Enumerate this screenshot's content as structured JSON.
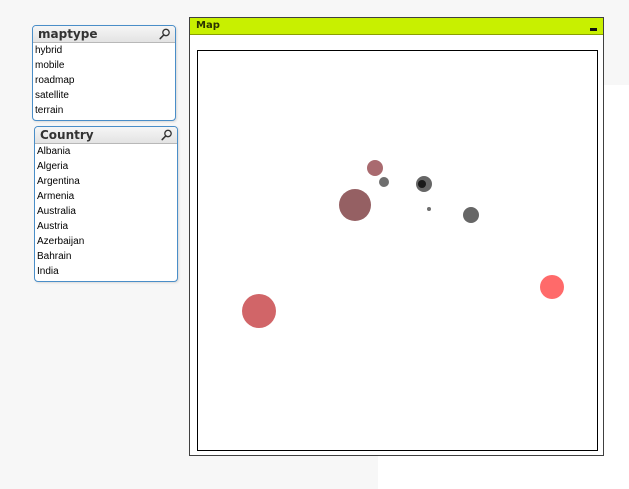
{
  "maptype_listbox": {
    "title": "maptype",
    "icon": "search-icon",
    "items": [
      "hybrid",
      "mobile",
      "roadmap",
      "satellite",
      "terrain"
    ]
  },
  "country_listbox": {
    "title": "Country",
    "icon": "search-icon",
    "items": [
      "Albania",
      "Algeria",
      "Argentina",
      "Armenia",
      "Australia",
      "Austria",
      "Azerbaijan",
      "Bahrain",
      "India"
    ]
  },
  "map_panel": {
    "title": "Map",
    "minimize_icon": "minimize-icon",
    "header_color": "#c8f000",
    "points": [
      {
        "color": "#a05a5f"
      },
      {
        "color": "#555555"
      },
      {
        "color": "#404040"
      },
      {
        "color": "#1a1a1a"
      },
      {
        "color": "#8a4f52"
      },
      {
        "color": "#555555"
      },
      {
        "color": "#555555"
      },
      {
        "color": "#c94a4e"
      },
      {
        "color": "#ff5a5a"
      }
    ]
  }
}
